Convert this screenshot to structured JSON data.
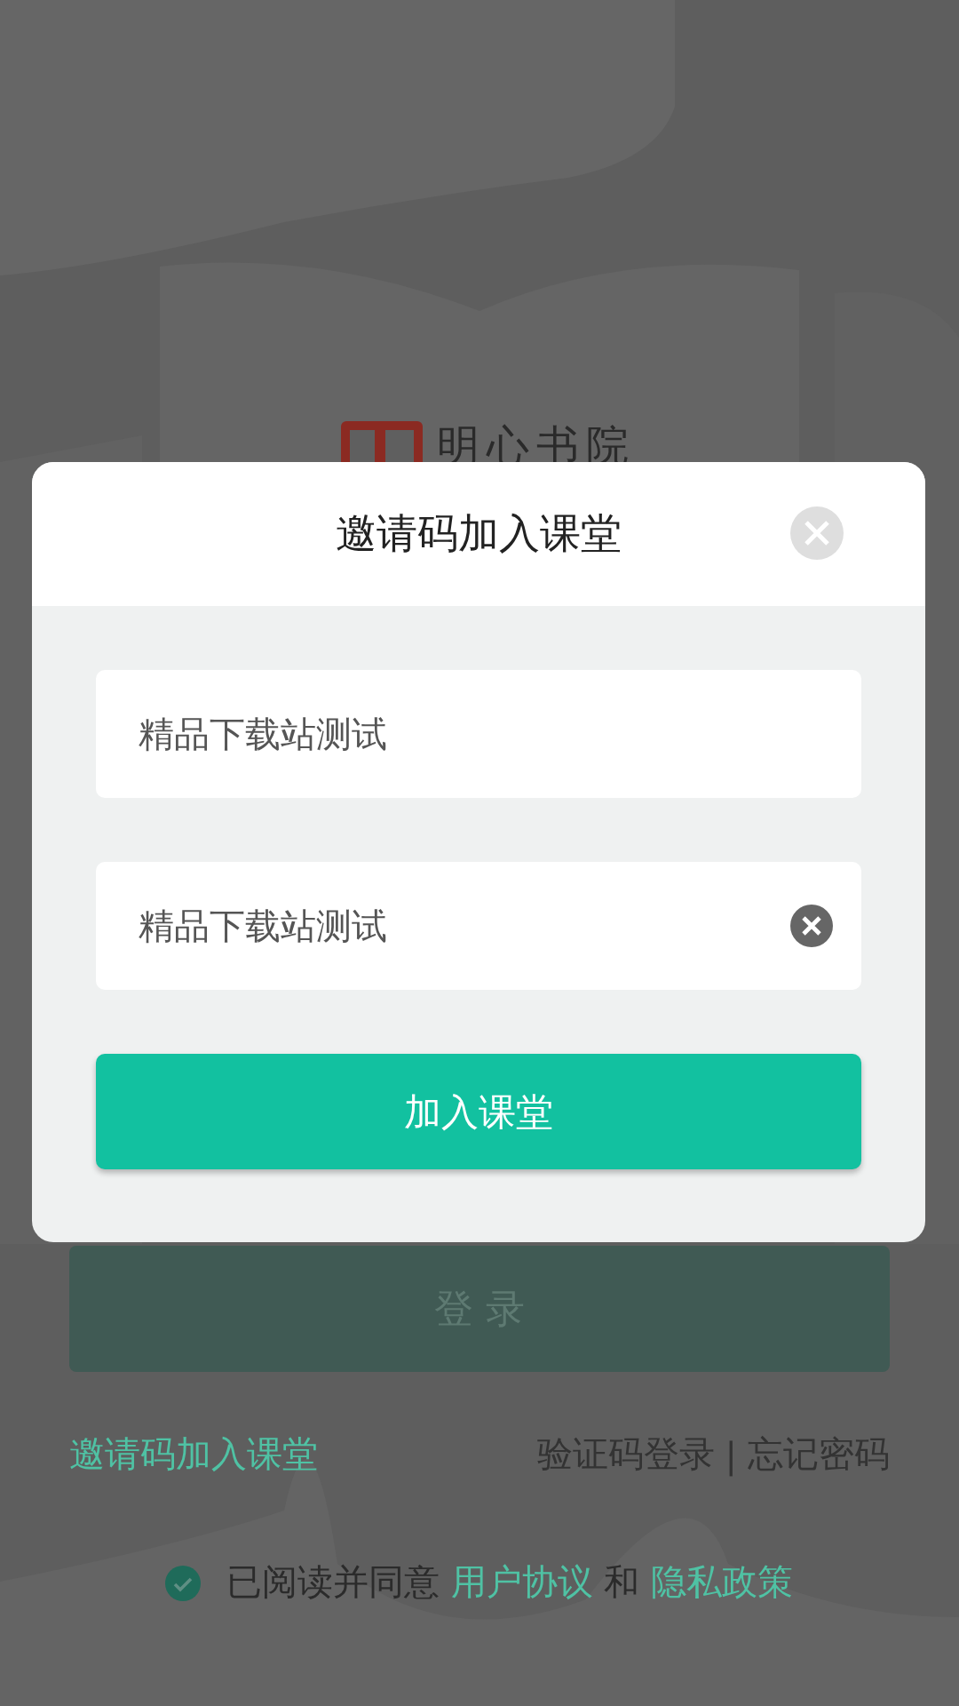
{
  "logo": {
    "name": "明心书院"
  },
  "login_button": {
    "label": "登 录",
    "disabled": true
  },
  "links": {
    "invite": "邀请码加入课堂",
    "sms_login": "验证码登录",
    "separator": "|",
    "forgot": "忘记密码"
  },
  "agreement": {
    "checked": true,
    "parts": [
      {
        "kind": "text",
        "text": "已阅读并同意 "
      },
      {
        "kind": "link",
        "text": "用户协议"
      },
      {
        "kind": "text",
        "text": " 和 "
      },
      {
        "kind": "link",
        "text": "隐私政策"
      }
    ]
  },
  "dialog": {
    "title": "邀请码加入课堂",
    "fields": [
      {
        "value": "精品下载站测试",
        "clear_button": false
      },
      {
        "value": "精品下载站测试",
        "clear_button": true
      }
    ],
    "submit": "加入课堂"
  }
}
